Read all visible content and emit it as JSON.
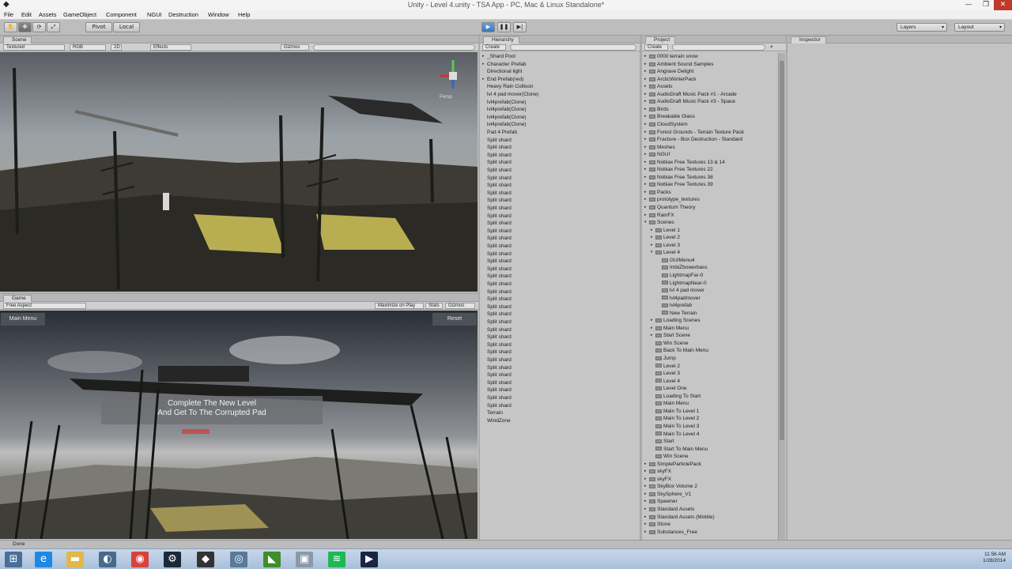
{
  "window": {
    "title": "Unity - Level 4.unity - TSA App - PC, Mac & Linux Standalone*",
    "app_icon": "unity-logo-icon",
    "minimize": "—",
    "maximize": "❐",
    "close": "✕"
  },
  "menu": [
    "File",
    "Edit",
    "Assets",
    "GameObject",
    "Component",
    "NGUI",
    "Destruction",
    "Window",
    "Help"
  ],
  "toolbar": {
    "hand": "✋",
    "move": "✥",
    "rotate": "⟳",
    "scale": "⤢",
    "pivot": "Pivot",
    "local": "Local",
    "play": "▶",
    "pause": "❚❚",
    "step": "▶|",
    "layers": "Layers",
    "layout": "Layout"
  },
  "scene": {
    "tab": "Scene",
    "shading": "Textured",
    "render_mode": "RGB",
    "mode_2d": "2D",
    "effects": "Effects",
    "gizmos": "Gizmos",
    "persp": "Persp"
  },
  "game": {
    "tab": "Game",
    "aspect": "Free Aspect",
    "maximize": "Maximize on Play",
    "stats": "Stats",
    "gizmos": "Gizmos",
    "main_menu_button": "Main Menu",
    "reset_button": "Reset",
    "message_line1": "Complete The New Level",
    "message_line2": "And Get To The Corrupted Pad"
  },
  "hierarchy": {
    "tab": "Hierarchy",
    "create": "Create",
    "items": [
      {
        "label": "_Shard Pool",
        "arrow": "▸"
      },
      {
        "label": "Character Prefab",
        "arrow": "▸"
      },
      {
        "label": "Directional light",
        "arrow": ""
      },
      {
        "label": "End Prefab(red)",
        "arrow": "▸"
      },
      {
        "label": "Heavy Rain Collison",
        "arrow": ""
      },
      {
        "label": "lvl 4 pad mover(Clone)",
        "arrow": ""
      },
      {
        "label": "lvl4prefab(Clone)",
        "arrow": ""
      },
      {
        "label": "lvl4prefab(Clone)",
        "arrow": ""
      },
      {
        "label": "lvl4prefab(Clone)",
        "arrow": ""
      },
      {
        "label": "lvl4prefab(Clone)",
        "arrow": ""
      },
      {
        "label": "Pad 4 Prefab",
        "arrow": ""
      },
      {
        "label": "Split shard",
        "arrow": ""
      },
      {
        "label": "Split shard",
        "arrow": ""
      },
      {
        "label": "Split shard",
        "arrow": ""
      },
      {
        "label": "Split shard",
        "arrow": ""
      },
      {
        "label": "Split shard",
        "arrow": ""
      },
      {
        "label": "Split shard",
        "arrow": ""
      },
      {
        "label": "Split shard",
        "arrow": ""
      },
      {
        "label": "Split shard",
        "arrow": ""
      },
      {
        "label": "Split shard",
        "arrow": ""
      },
      {
        "label": "Split shard",
        "arrow": ""
      },
      {
        "label": "Split shard",
        "arrow": ""
      },
      {
        "label": "Split shard",
        "arrow": ""
      },
      {
        "label": "Split shard",
        "arrow": ""
      },
      {
        "label": "Split shard",
        "arrow": ""
      },
      {
        "label": "Split shard",
        "arrow": ""
      },
      {
        "label": "Split shard",
        "arrow": ""
      },
      {
        "label": "Split shard",
        "arrow": ""
      },
      {
        "label": "Split shard",
        "arrow": ""
      },
      {
        "label": "Split shard",
        "arrow": ""
      },
      {
        "label": "Split shard",
        "arrow": ""
      },
      {
        "label": "Split shard",
        "arrow": ""
      },
      {
        "label": "Split shard",
        "arrow": ""
      },
      {
        "label": "Split shard",
        "arrow": ""
      },
      {
        "label": "Split shard",
        "arrow": ""
      },
      {
        "label": "Split shard",
        "arrow": ""
      },
      {
        "label": "Split shard",
        "arrow": ""
      },
      {
        "label": "Split shard",
        "arrow": ""
      },
      {
        "label": "Split shard",
        "arrow": ""
      },
      {
        "label": "Split shard",
        "arrow": ""
      },
      {
        "label": "Split shard",
        "arrow": ""
      },
      {
        "label": "Split shard",
        "arrow": ""
      },
      {
        "label": "Split shard",
        "arrow": ""
      },
      {
        "label": "Split shard",
        "arrow": ""
      },
      {
        "label": "Split shard",
        "arrow": ""
      },
      {
        "label": "Split shard",
        "arrow": ""
      },
      {
        "label": "Split shard",
        "arrow": ""
      },
      {
        "label": "Terrain",
        "arrow": ""
      },
      {
        "label": "WindZone",
        "arrow": ""
      }
    ]
  },
  "project": {
    "tab": "Project",
    "create": "Create",
    "search_icon": "search-icon",
    "items": [
      {
        "label": "0000 terrain snow",
        "arrow": "▸",
        "depth": 0
      },
      {
        "label": "Ambient Sound Samples",
        "arrow": "▸",
        "depth": 0
      },
      {
        "label": "Angrave Delight",
        "arrow": "▸",
        "depth": 0
      },
      {
        "label": "ArcticWinterPack",
        "arrow": "▸",
        "depth": 0
      },
      {
        "label": "Assets",
        "arrow": "▸",
        "depth": 0
      },
      {
        "label": "AudioDraft Music Pack #1 - Arcade",
        "arrow": "▸",
        "depth": 0
      },
      {
        "label": "AudioDraft Music Pack #3 - Space",
        "arrow": "▸",
        "depth": 0
      },
      {
        "label": "Birds",
        "arrow": "▸",
        "depth": 0
      },
      {
        "label": "Breakable Glass",
        "arrow": "▸",
        "depth": 0
      },
      {
        "label": "CloudSystem",
        "arrow": "▸",
        "depth": 0
      },
      {
        "label": "Forest Grounds - Terrain Texture Pack",
        "arrow": "▸",
        "depth": 0
      },
      {
        "label": "Fracture - Box Destruction - Standard",
        "arrow": "▸",
        "depth": 0
      },
      {
        "label": "Meshes",
        "arrow": "▸",
        "depth": 0
      },
      {
        "label": "NGUI",
        "arrow": "▸",
        "depth": 0
      },
      {
        "label": "Nobiax Free Textures 13 & 14",
        "arrow": "▸",
        "depth": 0
      },
      {
        "label": "Nobiax Free Textures 22",
        "arrow": "▸",
        "depth": 0
      },
      {
        "label": "Nobiax Free Textures 38",
        "arrow": "▸",
        "depth": 0
      },
      {
        "label": "Nobiax Free Textures 39",
        "arrow": "▸",
        "depth": 0
      },
      {
        "label": "Packs",
        "arrow": "▸",
        "depth": 0
      },
      {
        "label": "prototype_textures",
        "arrow": "▸",
        "depth": 0
      },
      {
        "label": "Quantum Theory",
        "arrow": "▸",
        "depth": 0
      },
      {
        "label": "RainFX",
        "arrow": "▸",
        "depth": 0
      },
      {
        "label": "Scenes",
        "arrow": "▾",
        "depth": 0
      },
      {
        "label": "Level 1",
        "arrow": "▸",
        "depth": 1
      },
      {
        "label": "Level 2",
        "arrow": "▸",
        "depth": 1
      },
      {
        "label": "Level 3",
        "arrow": "▸",
        "depth": 1
      },
      {
        "label": "Level 4",
        "arrow": "▾",
        "depth": 1
      },
      {
        "label": "GUIMenu4",
        "arrow": "",
        "depth": 2
      },
      {
        "label": "ImbiZbowerbass",
        "arrow": "",
        "depth": 2
      },
      {
        "label": "LightmapFar-0",
        "arrow": "",
        "depth": 2
      },
      {
        "label": "LightmapNear-0",
        "arrow": "",
        "depth": 2
      },
      {
        "label": "lvl 4 pad mover",
        "arrow": "",
        "depth": 2
      },
      {
        "label": "lvl4padmover",
        "arrow": "",
        "depth": 2
      },
      {
        "label": "lvl4prefab",
        "arrow": "",
        "depth": 2
      },
      {
        "label": "New Terrain",
        "arrow": "",
        "depth": 2
      },
      {
        "label": "Loading Scenes",
        "arrow": "▸",
        "depth": 1
      },
      {
        "label": "Main Menu",
        "arrow": "▸",
        "depth": 1
      },
      {
        "label": "Start Scene",
        "arrow": "▸",
        "depth": 1
      },
      {
        "label": "Win Scene",
        "arrow": "",
        "depth": 1
      },
      {
        "label": "Back To Main Menu",
        "arrow": "",
        "depth": 1
      },
      {
        "label": "Jump",
        "arrow": "",
        "depth": 1
      },
      {
        "label": "Level 2",
        "arrow": "",
        "depth": 1
      },
      {
        "label": "Level 3",
        "arrow": "",
        "depth": 1
      },
      {
        "label": "Level 4",
        "arrow": "",
        "depth": 1
      },
      {
        "label": "Level One",
        "arrow": "",
        "depth": 1
      },
      {
        "label": "Loading To Start",
        "arrow": "",
        "depth": 1
      },
      {
        "label": "Main Menu",
        "arrow": "",
        "depth": 1
      },
      {
        "label": "Main To Level 1",
        "arrow": "",
        "depth": 1
      },
      {
        "label": "Main To Level 2",
        "arrow": "",
        "depth": 1
      },
      {
        "label": "Main To Level 3",
        "arrow": "",
        "depth": 1
      },
      {
        "label": "Main To Level 4",
        "arrow": "",
        "depth": 1
      },
      {
        "label": "Start",
        "arrow": "",
        "depth": 1
      },
      {
        "label": "Start To Main Menu",
        "arrow": "",
        "depth": 1
      },
      {
        "label": "Win Scene",
        "arrow": "",
        "depth": 1
      },
      {
        "label": "SimpleParticlePack",
        "arrow": "▸",
        "depth": 0
      },
      {
        "label": "skyFX",
        "arrow": "▸",
        "depth": 0
      },
      {
        "label": "skyFX",
        "arrow": "▸",
        "depth": 0
      },
      {
        "label": "SkyBox Volume 2",
        "arrow": "▸",
        "depth": 0
      },
      {
        "label": "SkySphere_V1",
        "arrow": "▸",
        "depth": 0
      },
      {
        "label": "Spawner",
        "arrow": "▸",
        "depth": 0
      },
      {
        "label": "Standard Assets",
        "arrow": "▸",
        "depth": 0
      },
      {
        "label": "Standard Assets (Mobile)",
        "arrow": "▸",
        "depth": 0
      },
      {
        "label": "Stone",
        "arrow": "▸",
        "depth": 0
      },
      {
        "label": "Substances_Free",
        "arrow": "▸",
        "depth": 0
      }
    ]
  },
  "inspector": {
    "tab": "Inspector"
  },
  "status": {
    "text": "Done"
  },
  "taskbar": {
    "start": "⊞",
    "apps": [
      {
        "icon": "ie-icon",
        "glyph": "e",
        "color": "#1e88e5"
      },
      {
        "icon": "file-explorer-icon",
        "glyph": "▬",
        "color": "#e0b84a"
      },
      {
        "icon": "media-icon",
        "glyph": "◐",
        "color": "#4a6a8a"
      },
      {
        "icon": "chrome-icon",
        "glyph": "◉",
        "color": "#d9413a"
      },
      {
        "icon": "steam-icon",
        "glyph": "⚙",
        "color": "#1b2838"
      },
      {
        "icon": "unity-icon",
        "glyph": "◆",
        "color": "#333333"
      },
      {
        "icon": "settings-icon",
        "glyph": "◎",
        "color": "#5a7a9a"
      },
      {
        "icon": "nvidia-icon",
        "glyph": "◣",
        "color": "#3e8e2a"
      },
      {
        "icon": "network-icon",
        "glyph": "▣",
        "color": "#8a9aaa"
      },
      {
        "icon": "spotify-icon",
        "glyph": "≋",
        "color": "#1db954"
      },
      {
        "icon": "recorder-icon",
        "glyph": "▶",
        "color": "#1a2540"
      }
    ],
    "time": "11:56 AM",
    "date": "1/28/2014"
  }
}
